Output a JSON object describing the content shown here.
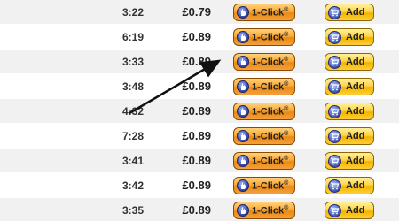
{
  "tracks": [
    {
      "time": "3:22",
      "price": "£0.79"
    },
    {
      "time": "6:19",
      "price": "£0.89"
    },
    {
      "time": "3:33",
      "price": "£0.89"
    },
    {
      "time": "3:48",
      "price": "£0.89"
    },
    {
      "time": "4:32",
      "price": "£0.89"
    },
    {
      "time": "7:28",
      "price": "£0.89"
    },
    {
      "time": "3:41",
      "price": "£0.89"
    },
    {
      "time": "3:42",
      "price": "£0.89"
    },
    {
      "time": "3:35",
      "price": "£0.89"
    }
  ],
  "buttons": {
    "one_click_label": "1-Click",
    "one_click_mark": "®",
    "add_label": "Add"
  },
  "icons": {
    "one_click": "hand-cursor-icon",
    "add": "shopping-cart-icon"
  },
  "colors": {
    "one_click_button": "#f9a83a",
    "add_button": "#ffd34a",
    "row_alt": "#f1f1f1",
    "annotation_arrow": "#111111"
  }
}
